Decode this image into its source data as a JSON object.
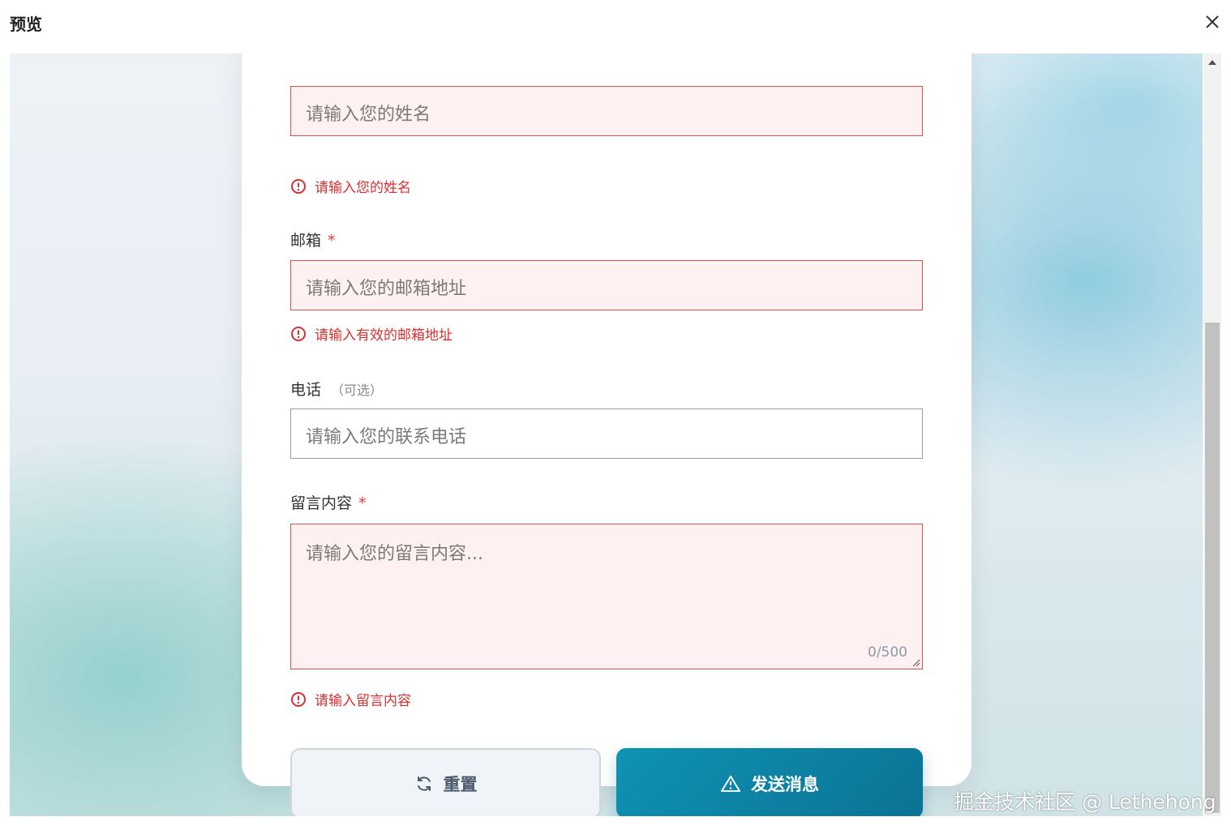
{
  "dialog": {
    "title": "预览"
  },
  "form": {
    "name": {
      "placeholder": "请输入您的姓名",
      "error": "请输入您的姓名"
    },
    "email": {
      "label": "邮箱",
      "required_mark": "*",
      "placeholder": "请输入您的邮箱地址",
      "error": "请输入有效的邮箱地址"
    },
    "phone": {
      "label": "电话",
      "optional_note": "（可选）",
      "placeholder": "请输入您的联系电话"
    },
    "message": {
      "label": "留言内容",
      "required_mark": "*",
      "placeholder": "请输入您的留言内容...",
      "counter": "0/500",
      "error": "请输入留言内容"
    },
    "reset_label": "重置",
    "send_label": "发送消息"
  },
  "watermark": "掘金技术社区 @ Lethehong",
  "icons": {
    "close": "close-icon",
    "error": "alert-circle-icon",
    "reset": "refresh-icon",
    "send": "warning-triangle-icon"
  },
  "colors": {
    "error": "#d93030",
    "primary": "#0f93b4"
  }
}
